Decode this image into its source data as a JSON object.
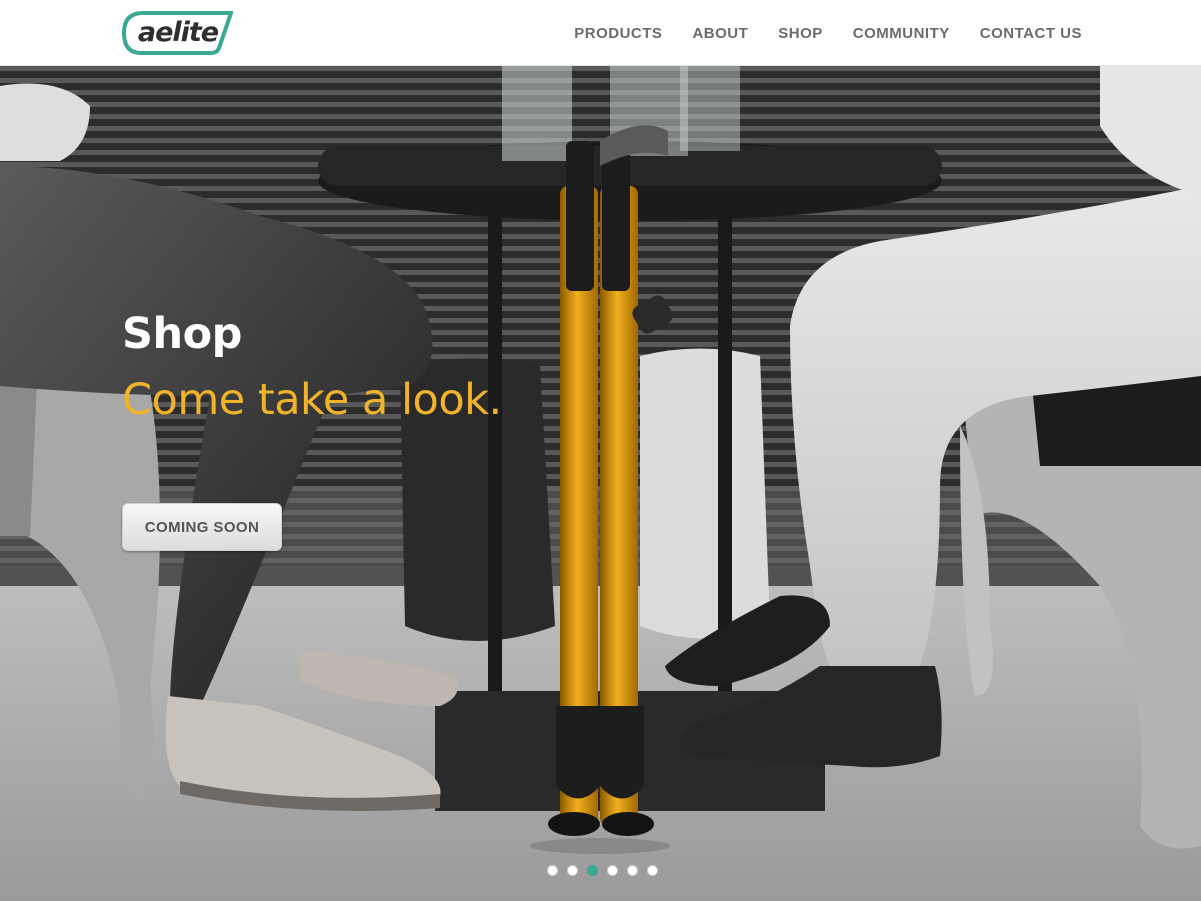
{
  "brand": {
    "logo_text": "aelite",
    "accent_color": "#3aa892"
  },
  "nav": {
    "items": [
      {
        "label": "PRODUCTS"
      },
      {
        "label": "ABOUT"
      },
      {
        "label": "SHOP"
      },
      {
        "label": "COMMUNITY"
      },
      {
        "label": "CONTACT US"
      }
    ]
  },
  "hero": {
    "headline": "Shop",
    "tagline": "Come take a look.",
    "tagline_color": "#f0b32a",
    "cta_label": "COMING SOON",
    "slides": {
      "count": 6,
      "active_index": 2
    }
  }
}
